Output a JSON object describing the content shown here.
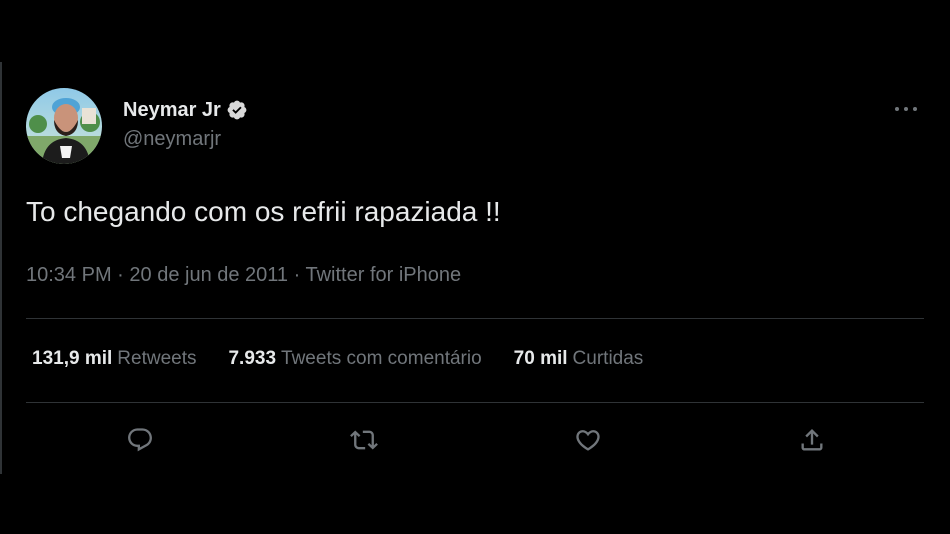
{
  "tweet": {
    "author": {
      "display_name": "Neymar Jr",
      "handle": "@neymarjr",
      "verified": true,
      "avatar_icon": "avatar-photo"
    },
    "text": "To chegando com os refrii rapaziada !!",
    "time": "10:34 PM",
    "date": "20 de jun de 2011",
    "source": "Twitter for iPhone",
    "separator": "·",
    "stats": {
      "retweets_count": "131,9 mil",
      "retweets_label": "Retweets",
      "quotes_count": "7.933",
      "quotes_label": "Tweets com comentário",
      "likes_count": "70 mil",
      "likes_label": "Curtidas"
    },
    "actions": [
      "reply-icon",
      "retweet-icon",
      "like-icon",
      "share-icon"
    ]
  },
  "colors": {
    "background": "#000000",
    "primary_text": "#e7e9ea",
    "secondary_text": "#71767b",
    "divider": "#2f3336",
    "verified_badge": "#d9d9d9"
  }
}
